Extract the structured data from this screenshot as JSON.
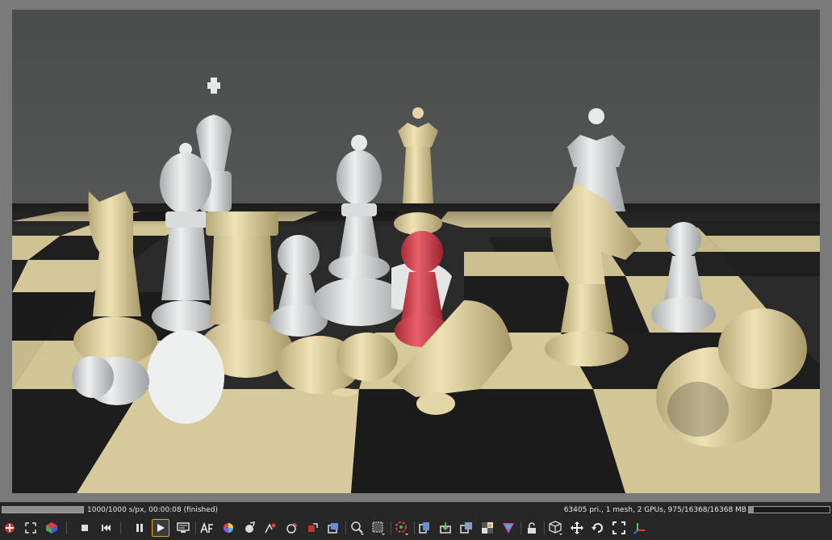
{
  "status": {
    "progress_text": "1000/1000 s/px, 00:00:08 (finished)",
    "progress_fraction": 1.0,
    "stats_text": "63405 pri., 1 mesh, 2 GPUs, 975/16368/16368 MB",
    "memory_fraction": 0.06
  },
  "toolbar": {
    "groups": [
      [
        "open-scene-icon",
        "fit-view-icon",
        "rgb-cube-icon"
      ],
      [
        "stop-render-icon",
        "restart-render-icon"
      ],
      [
        "pause-render-icon",
        "start-render-icon",
        "monitor-icon"
      ],
      [
        "autofocus-icon",
        "color-wheel-icon",
        "material-picker-icon",
        "camera-pick-icon",
        "region-pick-icon",
        "region-render-icon",
        "export-icon"
      ],
      [
        "zoom-icon",
        "render-region-icon"
      ],
      [
        "render-passes-icon"
      ],
      [
        "copy-icon",
        "save-icon",
        "layers-icon",
        "texture-icon",
        "colour-gamut-icon"
      ],
      [
        "lock-icon"
      ],
      [
        "box-icon",
        "move-icon",
        "rotate-icon",
        "fullscreen-icon",
        "axes-icon"
      ]
    ]
  },
  "colors": {
    "accent": "#d6aa2e",
    "background": "#262626",
    "pawn_red": "#d84350"
  }
}
